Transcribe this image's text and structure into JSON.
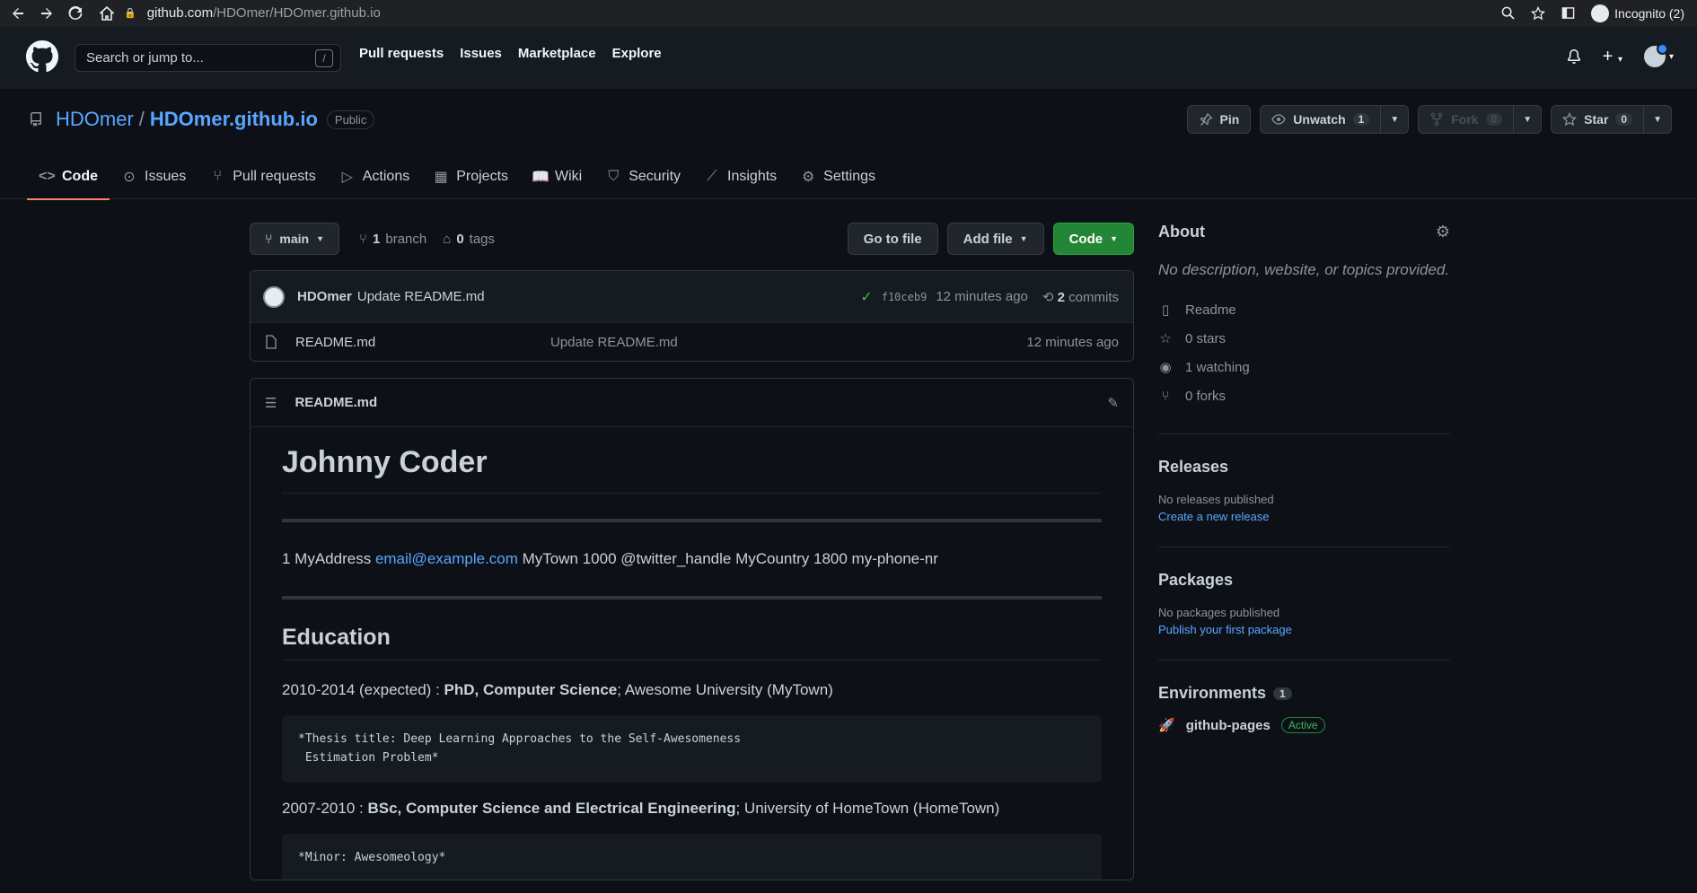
{
  "browser": {
    "url_host": "github.com",
    "url_path": "/HDOmer/HDOmer.github.io",
    "incognito_label": "Incognito (2)"
  },
  "header": {
    "search_placeholder": "Search or jump to...",
    "search_shortcut": "/",
    "nav": [
      "Pull requests",
      "Issues",
      "Marketplace",
      "Explore"
    ]
  },
  "repo": {
    "owner": "HDOmer",
    "separator": "/",
    "name": "HDOmer.github.io",
    "visibility": "Public",
    "pin_label": "Pin",
    "unwatch_label": "Unwatch",
    "unwatch_count": "1",
    "fork_label": "Fork",
    "fork_count": "0",
    "star_label": "Star",
    "star_count": "0",
    "tabs": [
      {
        "label": "Code",
        "icon": "code-icon"
      },
      {
        "label": "Issues",
        "icon": "issue-icon"
      },
      {
        "label": "Pull requests",
        "icon": "pull-request-icon"
      },
      {
        "label": "Actions",
        "icon": "play-icon"
      },
      {
        "label": "Projects",
        "icon": "table-icon"
      },
      {
        "label": "Wiki",
        "icon": "book-icon"
      },
      {
        "label": "Security",
        "icon": "shield-icon"
      },
      {
        "label": "Insights",
        "icon": "graph-icon"
      },
      {
        "label": "Settings",
        "icon": "gear-icon"
      }
    ]
  },
  "filenav": {
    "branch": "main",
    "branch_count": "1",
    "branch_word": "branch",
    "tag_count": "0",
    "tag_word": "tags",
    "go_to_file": "Go to file",
    "add_file": "Add file",
    "code": "Code"
  },
  "commit": {
    "author": "HDOmer",
    "message": "Update README.md",
    "sha": "f10ceb9",
    "age": "12 minutes ago",
    "commit_count": "2",
    "commit_word": "commits"
  },
  "files": [
    {
      "name": "README.md",
      "message": "Update README.md",
      "age": "12 minutes ago"
    }
  ],
  "readme": {
    "filename": "README.md",
    "h1": "Johnny Coder",
    "contact_prefix": "1 MyAddress ",
    "contact_email": "email@example.com",
    "contact_suffix": " MyTown 1000 @twitter_handle MyCountry 1800 my-phone-nr",
    "h2": "Education",
    "edu1_prefix": "2010-2014 (expected) : ",
    "edu1_bold": "PhD, Computer Science",
    "edu1_suffix": "; Awesome University (MyTown)",
    "edu1_code": "*Thesis title: Deep Learning Approaches to the Self-Awesomeness\n Estimation Problem*",
    "edu2_prefix": "2007-2010 : ",
    "edu2_bold": "BSc, Computer Science and Electrical Engineering",
    "edu2_suffix": "; University of HomeTown (HomeTown)",
    "edu2_code": "*Minor: Awesomeology*"
  },
  "sidebar": {
    "about_title": "About",
    "about_desc": "No description, website, or topics provided.",
    "readme": "Readme",
    "stars": "0 stars",
    "watching": "1 watching",
    "forks": "0 forks",
    "releases_title": "Releases",
    "releases_none": "No releases published",
    "releases_link": "Create a new release",
    "packages_title": "Packages",
    "packages_none": "No packages published",
    "packages_link": "Publish your first package",
    "env_title": "Environments",
    "env_count": "1",
    "env_name": "github-pages",
    "env_status": "Active"
  },
  "colors": {
    "bg": "#0d1117",
    "header_bg": "#161b22",
    "link": "#58a6ff",
    "green": "#238636",
    "tab_underline": "#f78166"
  }
}
